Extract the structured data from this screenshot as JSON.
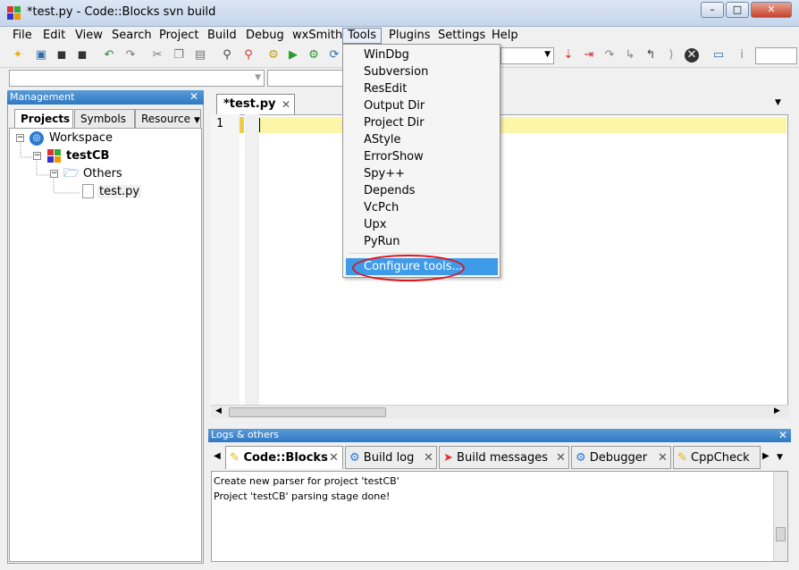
{
  "window": {
    "title": "*test.py - Code::Blocks svn build",
    "minimize": "–",
    "maximize": "□",
    "close": "✕"
  },
  "menubar": [
    "File",
    "Edit",
    "View",
    "Search",
    "Project",
    "Build",
    "Debug",
    "wxSmith",
    "Tools",
    "Plugins",
    "Settings",
    "Help"
  ],
  "tools_menu": {
    "items": [
      "WinDbg",
      "Subversion",
      "ResEdit",
      "Output Dir",
      "Project Dir",
      "AStyle",
      "ErrorShow",
      "Spy++",
      "Depends",
      "VcPch",
      "Upx",
      "PyRun"
    ],
    "configure": "Configure tools..."
  },
  "management": {
    "title": "Management",
    "tabs": [
      "Projects",
      "Symbols",
      "Resource"
    ],
    "tree": {
      "workspace": "Workspace",
      "project": "testCB",
      "folder": "Others",
      "file": "test.py"
    }
  },
  "editor": {
    "tab": "*test.py",
    "line_number": "1"
  },
  "logs": {
    "title": "Logs & others",
    "tabs": [
      "Code::Blocks",
      "Build log",
      "Build messages",
      "Debugger",
      "CppCheck"
    ],
    "lines": [
      "Create new parser for project 'testCB'",
      "Project 'testCB' parsing stage done!"
    ]
  },
  "colors": {
    "accent": "#3d9be9",
    "panel_header": "#2e78c5",
    "current_line": "#fdf6a8",
    "annotation": "#e0141a"
  }
}
